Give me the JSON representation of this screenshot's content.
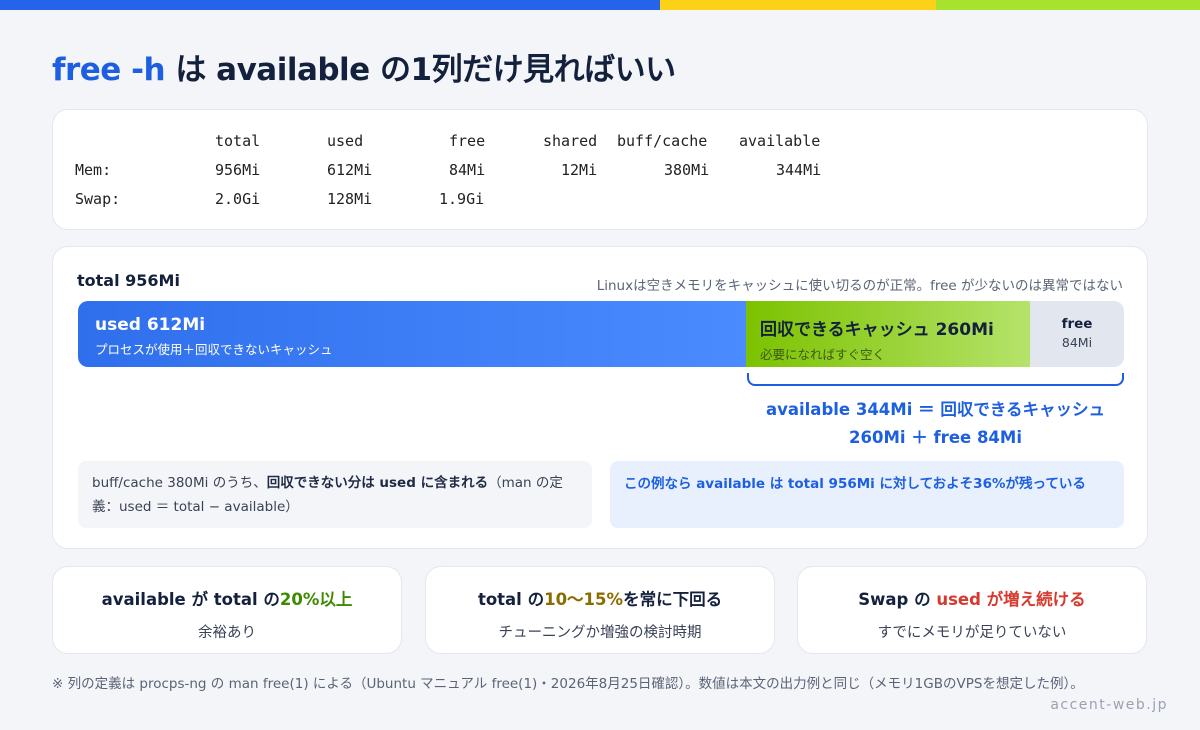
{
  "title": {
    "highlight": "free -h",
    "rest": " は available の1列だけ見ればいい"
  },
  "free_output": {
    "headers": [
      "total",
      "used",
      "free",
      "shared",
      "buff/cache",
      "available"
    ],
    "rows": [
      {
        "label": "Mem:",
        "values": [
          "956Mi",
          "612Mi",
          "84Mi",
          "12Mi",
          "380Mi",
          "344Mi"
        ]
      },
      {
        "label": "Swap:",
        "values": [
          "2.0Gi",
          "128Mi",
          "1.9Gi",
          "",
          "",
          ""
        ]
      }
    ]
  },
  "bar_card": {
    "total_label": "total 956Mi",
    "note": "Linuxは空きメモリをキャッシュに使い切るのが正常。free が少ないのは異常ではない",
    "used": {
      "title": "used 612Mi",
      "sub": "プロセスが使用＋回収できないキャッシュ",
      "value_mi": 612
    },
    "cache": {
      "title": "回収できるキャッシュ 260Mi",
      "sub": "必要になればすぐ空く",
      "value_mi": 260
    },
    "free": {
      "title": "free",
      "sub": "84Mi",
      "value_mi": 84
    },
    "available_line1": "available 344Mi ＝ 回収できるキャッシュ",
    "available_line2": "260Mi ＋ free 84Mi",
    "gray_note": {
      "pre": "buff/cache 380Mi のうち、",
      "bold": "回収できない分は used に含まれる",
      "post": "（man の定義：used ＝ total − available）"
    },
    "blue_note": "この例なら available は total 956Mi に対しておよそ36%が残っている"
  },
  "cards": [
    {
      "pre": "available が total の",
      "accent": "20%以上",
      "post": "",
      "desc": "余裕あり",
      "accent_color": "#3d8a00"
    },
    {
      "pre": "total の",
      "accent": "10〜15%",
      "post": "を常に下回る",
      "desc": "チューニングか増強の検討時期",
      "accent_color": "#8a6d00"
    },
    {
      "pre": "Swap の ",
      "accent": "used が増え続ける",
      "post": "",
      "desc": "すでにメモリが足りていない",
      "accent_color": "#d63a2f"
    }
  ],
  "footnote": "※ 列の定義は procps-ng の man free(1) による（Ubuntu マニュアル free(1)・2026年8月25日確認）。数値は本文の出力例と同じ（メモリ1GBのVPSを想定した例）。",
  "brand": "accent-web.jp",
  "colors": {
    "blue": "#2563eb",
    "yellow": "#fcd116",
    "green": "#a6e22e",
    "accent_blue": "#1d5fe0"
  }
}
